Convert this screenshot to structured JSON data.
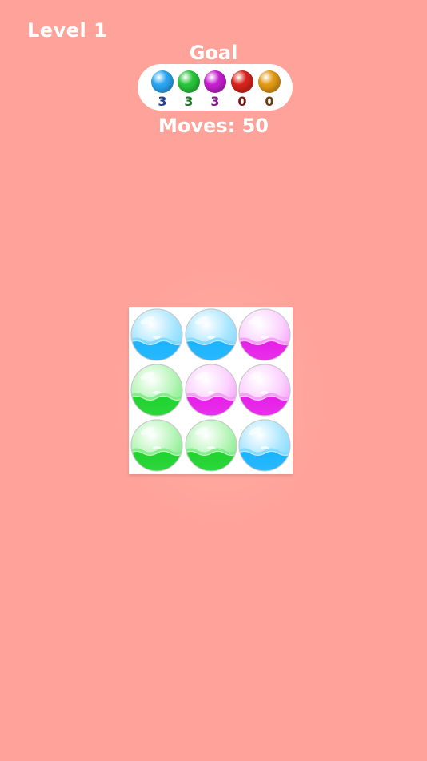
{
  "level_label": "Level 1",
  "goal": {
    "title": "Goal",
    "items": [
      {
        "color_name": "blue",
        "ball_color": "#2aa6f2",
        "count": "3",
        "count_color": "#1f3f9a"
      },
      {
        "color_name": "green",
        "ball_color": "#28c53a",
        "count": "3",
        "count_color": "#1e7a24"
      },
      {
        "color_name": "purple",
        "ball_color": "#c51fce",
        "count": "3",
        "count_color": "#8a1a8e"
      },
      {
        "color_name": "red",
        "ball_color": "#d8231c",
        "count": "0",
        "count_color": "#7a1a14"
      },
      {
        "color_name": "orange",
        "ball_color": "#e39a14",
        "count": "0",
        "count_color": "#6a4010"
      }
    ]
  },
  "moves_label": "Moves: 50",
  "board": {
    "grid": [
      [
        "blue",
        "blue",
        "purple"
      ],
      [
        "green",
        "purple",
        "purple"
      ],
      [
        "green",
        "green",
        "blue"
      ]
    ],
    "colors": {
      "blue": {
        "liquid": "#1ab3ff",
        "glass": "#a9e6ff",
        "wave": "#7fd8ff"
      },
      "green": {
        "liquid": "#1fd32e",
        "glass": "#b4f5b6",
        "wave": "#7fea86"
      },
      "purple": {
        "liquid": "#e61ee8",
        "glass": "#fbd0ff",
        "wave": "#f59af7"
      }
    }
  }
}
